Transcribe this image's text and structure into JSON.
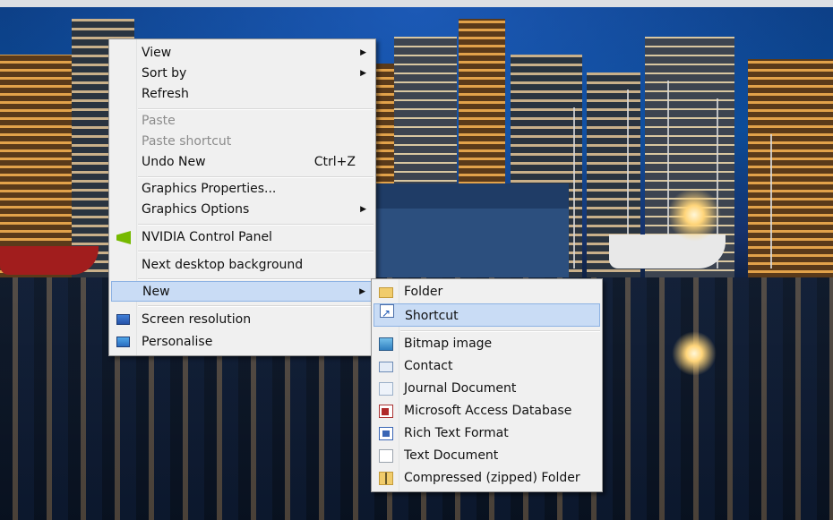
{
  "context_menu": {
    "items": [
      {
        "label": "View",
        "submenu": true
      },
      {
        "label": "Sort by",
        "submenu": true
      },
      {
        "label": "Refresh"
      },
      {
        "label": "Paste",
        "disabled": true
      },
      {
        "label": "Paste shortcut",
        "disabled": true
      },
      {
        "label": "Undo New",
        "shortcut": "Ctrl+Z"
      },
      {
        "label": "Graphics Properties..."
      },
      {
        "label": "Graphics Options",
        "submenu": true
      },
      {
        "label": "NVIDIA Control Panel",
        "icon": "nvidia-icon"
      },
      {
        "label": "Next desktop background"
      },
      {
        "label": "New",
        "submenu": true,
        "highlighted": true
      },
      {
        "label": "Screen resolution",
        "icon": "monitor-icon"
      },
      {
        "label": "Personalise",
        "icon": "personalise-icon"
      }
    ]
  },
  "new_submenu": {
    "items": [
      {
        "label": "Folder",
        "icon": "folder-icon"
      },
      {
        "label": "Shortcut",
        "icon": "shortcut-icon",
        "highlighted": true
      },
      {
        "label": "Bitmap image",
        "icon": "bitmap-icon"
      },
      {
        "label": "Contact",
        "icon": "contact-icon"
      },
      {
        "label": "Journal Document",
        "icon": "journal-icon"
      },
      {
        "label": "Microsoft Access Database",
        "icon": "access-icon"
      },
      {
        "label": "Rich Text Format",
        "icon": "rtf-icon"
      },
      {
        "label": "Text Document",
        "icon": "text-document-icon"
      },
      {
        "label": "Compressed (zipped) Folder",
        "icon": "zip-folder-icon"
      }
    ]
  },
  "colors": {
    "menu_bg": "#f0f0f0",
    "highlight": "#c9dcf5",
    "highlight_border": "#8db2e3",
    "disabled_text": "#8c8c8c"
  }
}
